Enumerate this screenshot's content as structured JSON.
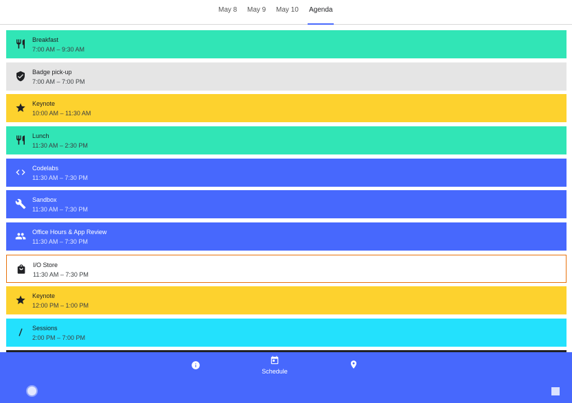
{
  "tabs": [
    {
      "label": "May 8",
      "active": false
    },
    {
      "label": "May 9",
      "active": false
    },
    {
      "label": "May 10",
      "active": false
    },
    {
      "label": "Agenda",
      "active": true
    }
  ],
  "colors": {
    "green": "#31e5b6",
    "grey": "#e5e5e5",
    "yellow": "#fdd22e",
    "blue": "#4768fd",
    "cyan": "#23e1fd",
    "white": "#ffffff",
    "store_border": "#e8710a",
    "accent": "#4768fd"
  },
  "agenda": [
    {
      "title": "Breakfast",
      "time": "7:00 AM – 9:30 AM",
      "icon": "restaurant-icon",
      "color": "green"
    },
    {
      "title": "Badge pick-up",
      "time": "7:00 AM – 7:00 PM",
      "icon": "badge-shield-icon",
      "color": "grey"
    },
    {
      "title": "Keynote",
      "time": "10:00 AM – 11:30 AM",
      "icon": "star-icon",
      "color": "yellow"
    },
    {
      "title": "Lunch",
      "time": "11:30 AM – 2:30 PM",
      "icon": "restaurant-icon",
      "color": "green"
    },
    {
      "title": "Codelabs",
      "time": "11:30 AM – 7:30 PM",
      "icon": "code-icon",
      "color": "blue"
    },
    {
      "title": "Sandbox",
      "time": "11:30 AM – 7:30 PM",
      "icon": "wrench-icon",
      "color": "blue"
    },
    {
      "title": "Office Hours & App Review",
      "time": "11:30 AM – 7:30 PM",
      "icon": "people-icon",
      "color": "blue"
    },
    {
      "title": "I/O Store",
      "time": "11:30 AM – 7:30 PM",
      "icon": "shopping-bag-icon",
      "color": "white"
    },
    {
      "title": "Keynote",
      "time": "12:00 PM – 1:00 PM",
      "icon": "star-icon",
      "color": "yellow"
    },
    {
      "title": "Sessions",
      "time": "2:00 PM – 7:00 PM",
      "icon": "slash-icon",
      "color": "cyan"
    }
  ],
  "bottom_nav": [
    {
      "icon": "info-icon",
      "label": ""
    },
    {
      "icon": "calendar-icon",
      "label": "Schedule"
    },
    {
      "icon": "map-pin-icon",
      "label": ""
    }
  ],
  "system_nav": [
    {
      "icon": "home-circle-icon"
    },
    {
      "icon": "recents-square-icon"
    }
  ]
}
